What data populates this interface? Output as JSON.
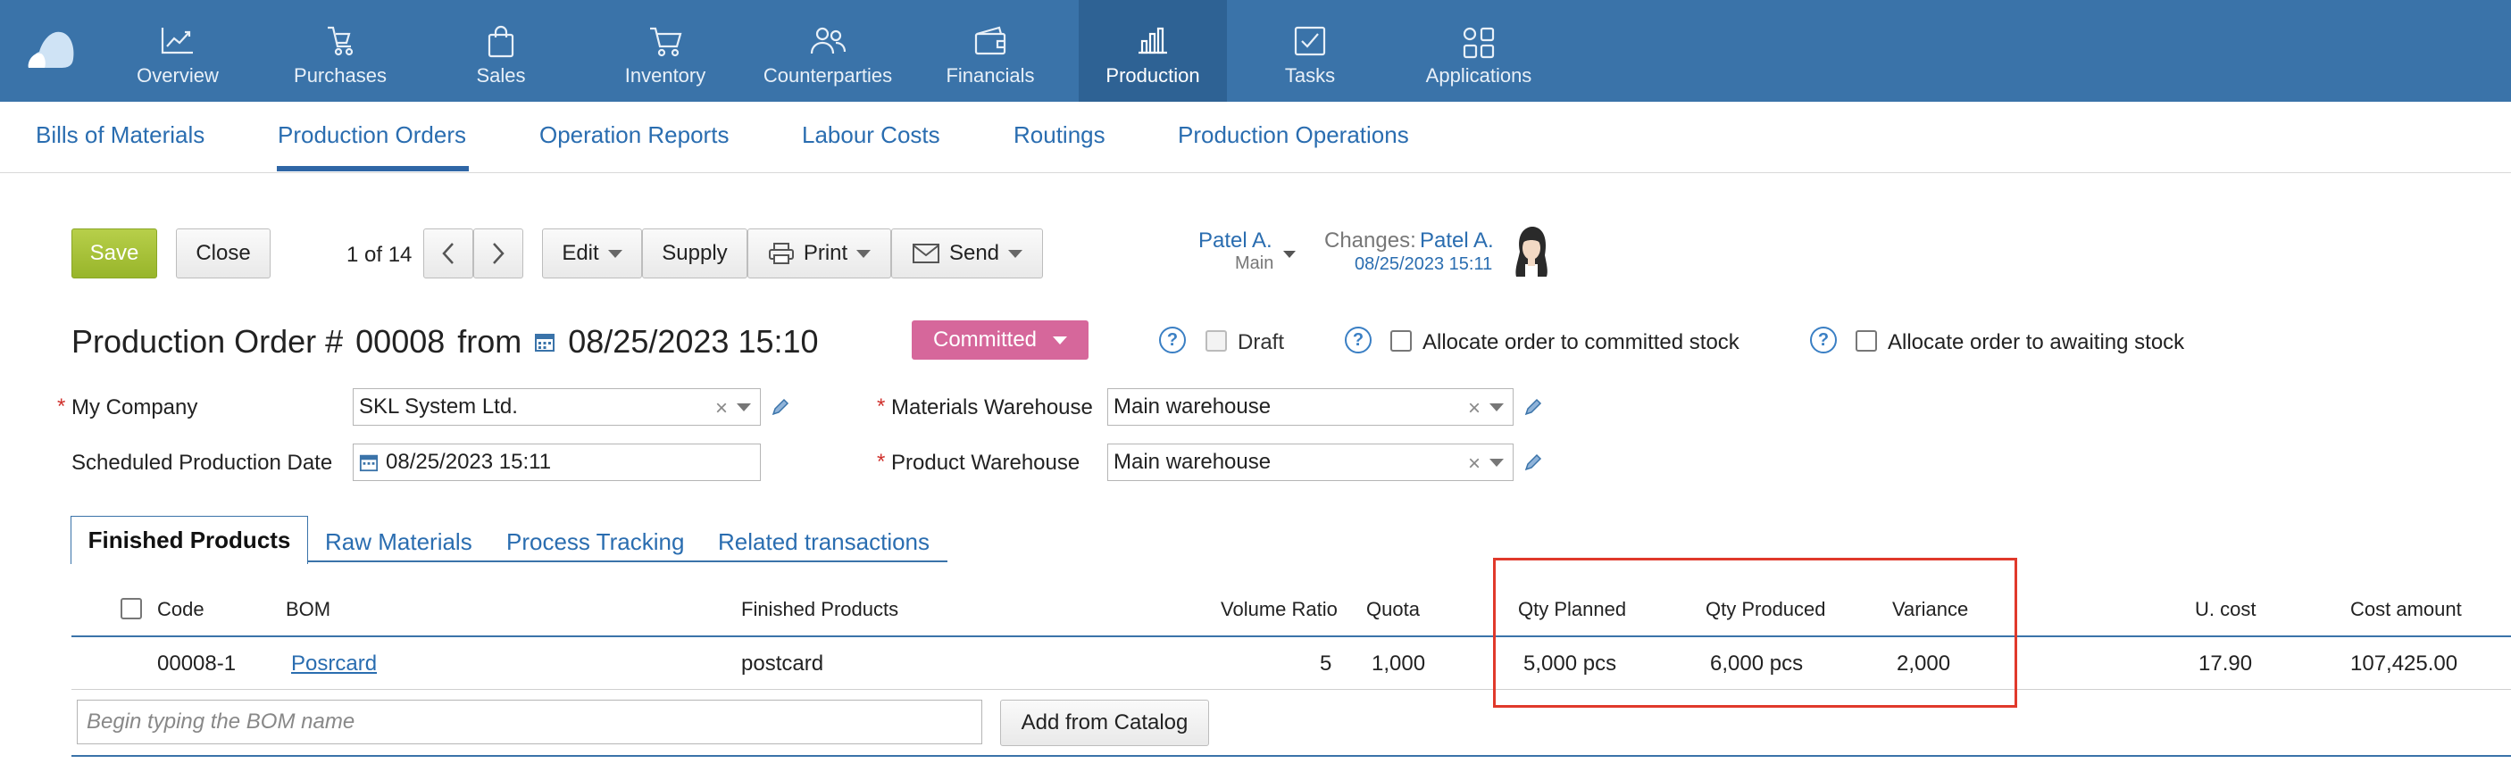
{
  "nav": {
    "items": [
      {
        "label": "Overview",
        "icon": "chart-line-icon"
      },
      {
        "label": "Purchases",
        "icon": "purchases-icon"
      },
      {
        "label": "Sales",
        "icon": "shopping-bag-icon"
      },
      {
        "label": "Inventory",
        "icon": "cart-icon"
      },
      {
        "label": "Counterparties",
        "icon": "people-icon"
      },
      {
        "label": "Financials",
        "icon": "wallet-icon"
      },
      {
        "label": "Production",
        "icon": "bar-chart-icon",
        "active": true
      },
      {
        "label": "Tasks",
        "icon": "checkbox-icon"
      },
      {
        "label": "Applications",
        "icon": "apps-grid-icon"
      }
    ],
    "accent": "#3a73a9"
  },
  "subnav": {
    "items": [
      {
        "label": "Bills of Materials"
      },
      {
        "label": "Production Orders",
        "active": true
      },
      {
        "label": "Operation Reports"
      },
      {
        "label": "Labour Costs"
      },
      {
        "label": "Routings"
      },
      {
        "label": "Production Operations"
      }
    ]
  },
  "toolbar": {
    "save": "Save",
    "close": "Close",
    "pager": "1 of 14",
    "edit": "Edit",
    "supply": "Supply",
    "print": "Print",
    "send": "Send"
  },
  "owner": {
    "name": "Patel A.",
    "group": "Main",
    "changes_label": "Changes:",
    "changes_by": "Patel A.",
    "changes_date": "08/25/2023 15:11"
  },
  "doc": {
    "title": "Production Order #",
    "number": "00008",
    "from": "from",
    "date": "08/25/2023 15:10",
    "status": "Committed",
    "status_color": "#d6679b",
    "draft_label": "Draft",
    "allocate_committed": "Allocate order to committed stock",
    "allocate_awaiting": "Allocate order to awaiting stock"
  },
  "form": {
    "my_company_label": "My Company",
    "my_company_value": "SKL System Ltd.",
    "scheduled_label": "Scheduled Production Date",
    "scheduled_value": "08/25/2023 15:11",
    "materials_wh_label": "Materials Warehouse",
    "materials_wh_value": "Main warehouse",
    "product_wh_label": "Product Warehouse",
    "product_wh_value": "Main warehouse"
  },
  "tabs": [
    {
      "label": "Finished Products",
      "active": true
    },
    {
      "label": "Raw Materials"
    },
    {
      "label": "Process Tracking"
    },
    {
      "label": "Related transactions"
    }
  ],
  "table": {
    "headers": {
      "code": "Code",
      "bom": "BOM",
      "finished": "Finished Products",
      "volume": "Volume Ratio",
      "quota": "Quota",
      "planned": "Qty Planned",
      "produced": "Qty Produced",
      "variance": "Variance",
      "ucost": "U. cost",
      "amount": "Cost amount"
    },
    "rows": [
      {
        "code": "00008-1",
        "bom": "Posrcard",
        "finished": "postcard",
        "volume": "5",
        "quota": "1,000",
        "planned": "5,000 pcs",
        "produced": "6,000 pcs",
        "variance": "2,000",
        "ucost": "17.90",
        "amount": "107,425.00"
      }
    ],
    "bom_placeholder": "Begin typing the BOM name",
    "add_from_catalog": "Add from Catalog"
  }
}
